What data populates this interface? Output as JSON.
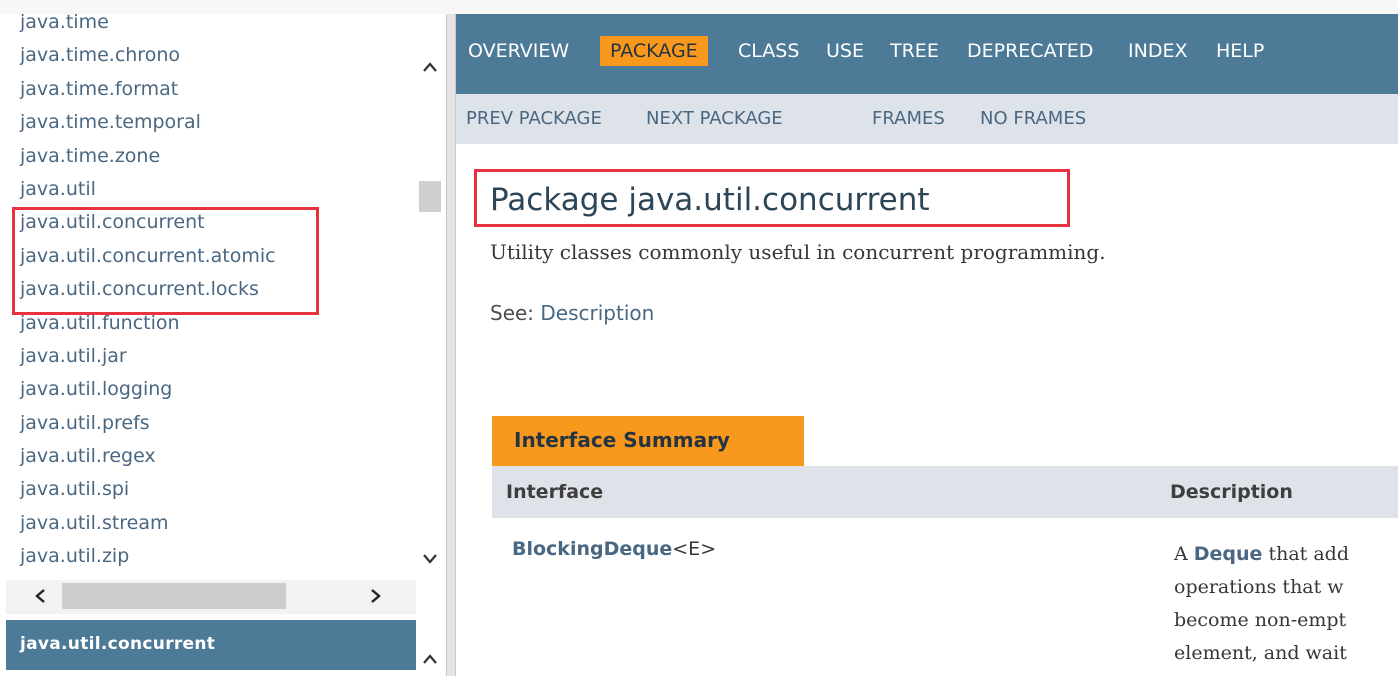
{
  "packages": [
    "java.time",
    "java.time.chrono",
    "java.time.format",
    "java.time.temporal",
    "java.time.zone",
    "java.util",
    "java.util.concurrent",
    "java.util.concurrent.atomic",
    "java.util.concurrent.locks",
    "java.util.function",
    "java.util.jar",
    "java.util.logging",
    "java.util.prefs",
    "java.util.regex",
    "java.util.spi",
    "java.util.stream",
    "java.util.zip"
  ],
  "package_frame": {
    "title": "java.util.concurrent"
  },
  "icons": {
    "scroll_up": "chevron-up-icon",
    "scroll_down": "chevron-down-icon",
    "scroll_left": "chevron-left-icon",
    "scroll_right": "chevron-right-icon"
  },
  "nav": {
    "overview": "OVERVIEW",
    "package": "PACKAGE",
    "class": "CLASS",
    "use": "USE",
    "tree": "TREE",
    "deprecated": "DEPRECATED",
    "index": "INDEX",
    "help": "HELP"
  },
  "subnav": {
    "prev_package": "PREV PACKAGE",
    "next_package": "NEXT PACKAGE",
    "frames": "FRAMES",
    "no_frames": "NO FRAMES"
  },
  "main": {
    "title": "Package java.util.concurrent",
    "description": "Utility classes commonly useful in concurrent programming.",
    "see_label": "See:",
    "see_link": "Description"
  },
  "summary": {
    "tab": "Interface Summary",
    "col_interface": "Interface",
    "col_description": "Description",
    "rows": [
      {
        "name": "BlockingDeque",
        "generic": "<E>",
        "desc_prefix": "A ",
        "desc_link": "Deque",
        "desc_line1_rest": " that add",
        "desc_line2": "operations that w",
        "desc_line3": "become non-empt",
        "desc_line4": "element, and wait"
      }
    ]
  },
  "colors": {
    "nav_bg": "#4d7a97",
    "active_tab": "#f8981d",
    "subnav_bg": "#dee3e9",
    "link": "#4a6782",
    "highlight_box": "#e8323e"
  }
}
